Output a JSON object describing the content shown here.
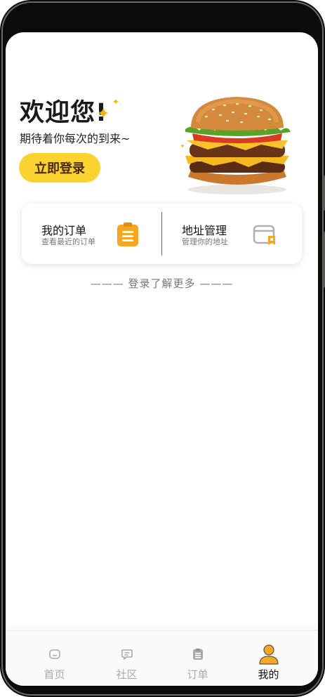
{
  "welcome": {
    "title": "欢迎您!",
    "subtitle": "期待着你每次的到来~",
    "login_button": "立即登录"
  },
  "cards": [
    {
      "title": "我的订单",
      "subtitle": "查看最近的订单",
      "icon": "clipboard-icon"
    },
    {
      "title": "地址管理",
      "subtitle": "管理你的地址",
      "icon": "address-card-icon"
    }
  ],
  "more_text": "——— 登录了解更多 ———",
  "tabbar": {
    "active": "我的",
    "items": [
      {
        "label": "首页",
        "icon": "home-icon"
      },
      {
        "label": "社区",
        "icon": "chat-icon"
      },
      {
        "label": "订单",
        "icon": "orders-icon"
      },
      {
        "label": "我的",
        "icon": "profile-icon"
      }
    ]
  },
  "colors": {
    "accent": "#fbd331",
    "icon_orange": "#f5a623",
    "muted": "#aaaaaa"
  }
}
